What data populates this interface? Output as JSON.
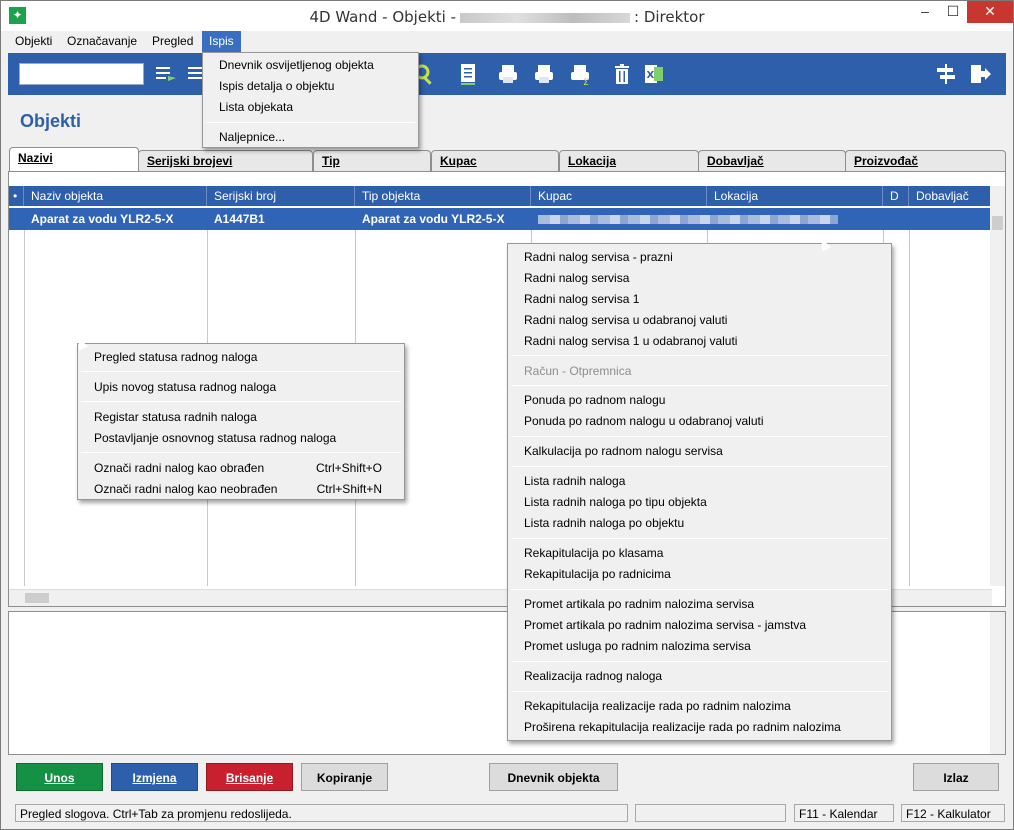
{
  "window": {
    "title_prefix": "4D Wand - Objekti -",
    "title_suffix": ": Direktor",
    "minimize": "–",
    "maximize": "☐",
    "close": "✕",
    "app_icon": "✦"
  },
  "menubar": [
    "Objekti",
    "Označavanje",
    "Pregled",
    "Ispis"
  ],
  "ispis_menu": {
    "items": [
      "Dnevnik osvijetljenog objekta",
      "Ispis detalja o objektu",
      "Lista objekata"
    ],
    "after_sep": "Naljepnice..."
  },
  "toolbar": {
    "search_value": "",
    "icons": [
      "list-arrow-icon",
      "list-icon",
      "search-icon",
      "document-icon",
      "printer-icon",
      "printer-icon",
      "printer-sum-icon",
      "trash-icon",
      "excel-icon",
      "signpost-icon",
      "exit-icon"
    ]
  },
  "page": {
    "title": "Objekti"
  },
  "tabs": [
    "Nazivi",
    "Serijski brojevi",
    "Tip",
    "Kupac",
    "Lokacija",
    "Dobavljač",
    "Proizvođač"
  ],
  "grid": {
    "marker": "•",
    "headers": [
      "Naziv objekta",
      "Serijski broj",
      "Tip objekta",
      "Kupac",
      "Lokacija",
      "D",
      "Dobavljač"
    ],
    "row": {
      "naziv": "Aparat za vodu YLR2-5-X",
      "serijski": "A1447B1",
      "tip": "Aparat za vodu YLR2-5-X"
    }
  },
  "context_menu_left": {
    "items": [
      {
        "label": "Pregled statusa radnog naloga",
        "shortcut": ""
      },
      {
        "label": "Upis novog statusa radnog naloga",
        "shortcut": ""
      },
      {
        "label": "Registar statusa radnih naloga",
        "shortcut": ""
      },
      {
        "label": "Postavljanje osnovnog statusa radnog naloga",
        "shortcut": ""
      },
      {
        "label": "Označi radni nalog kao obrađen",
        "shortcut": "Ctrl+Shift+O"
      },
      {
        "label": "Označi radni nalog kao neobrađen",
        "shortcut": "Ctrl+Shift+N"
      }
    ]
  },
  "context_menu_right": {
    "items": [
      "Radni nalog servisa - prazni",
      "Radni nalog servisa",
      "Radni nalog servisa 1",
      "Radni nalog servisa u odabranoj valuti",
      "Radni nalog servisa 1 u odabranoj valuti",
      "Račun - Otpremnica",
      "Ponuda po radnom nalogu",
      "Ponuda po radnom nalogu u odabranoj valuti",
      "Kalkulacija po radnom nalogu servisa",
      "Lista radnih naloga",
      "Lista radnih naloga po tipu objekta",
      "Lista radnih naloga po objektu",
      "Rekapitulacija po klasama",
      "Rekapitulacija po radnicima",
      "Promet artikala po radnim nalozima servisa",
      "Promet artikala po radnim nalozima servisa - jamstva",
      "Promet usluga po radnim nalozima servisa",
      "Realizacija radnog naloga",
      "Rekapitulacija realizacije rada po radnim nalozima",
      "Proširena rekapitulacija realizacije rada po radnim nalozima"
    ]
  },
  "buttons": {
    "unos": "Unos",
    "izmjena": "Izmjena",
    "brisanje": "Brisanje",
    "kopiranje": "Kopiranje",
    "dnevnik": "Dnevnik objekta",
    "izlaz": "Izlaz"
  },
  "status": {
    "message": "Pregled slogova. Ctrl+Tab za promjenu redoslijeda.",
    "f11": "F11 - Kalendar",
    "f12": "F12 - Kalkulator"
  },
  "colors": {
    "accent": "#2e5faa",
    "green": "#149144",
    "red": "#c8202e"
  }
}
